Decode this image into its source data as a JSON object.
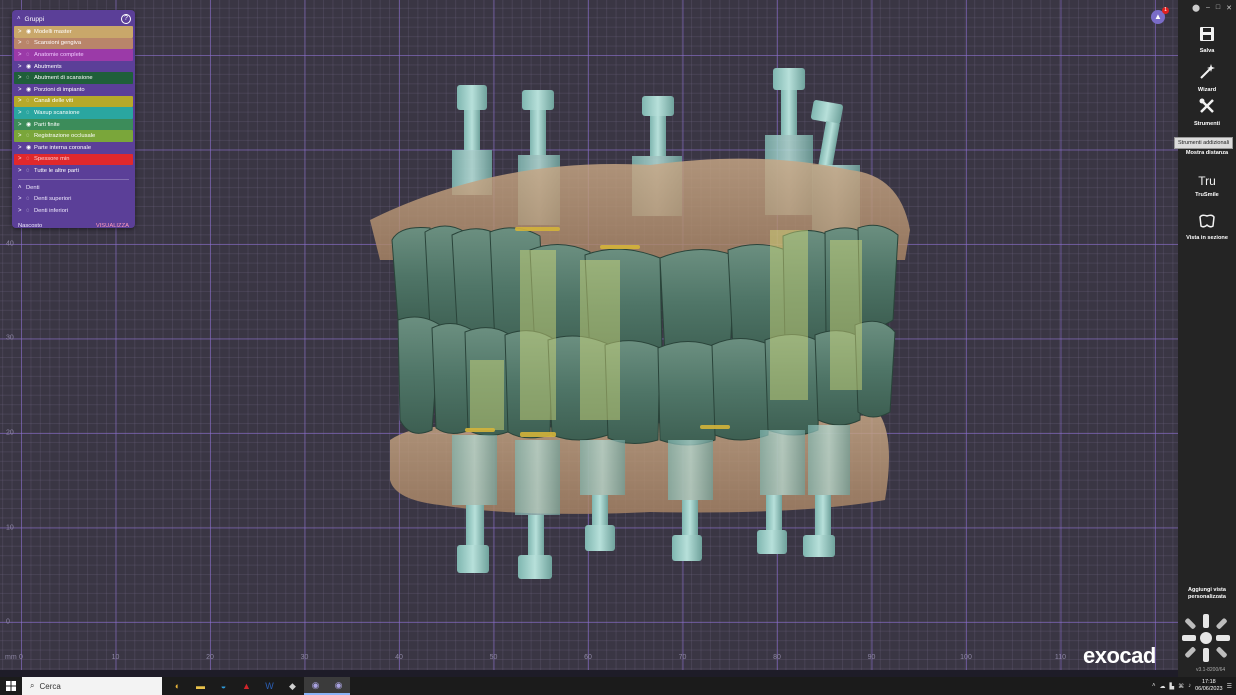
{
  "groups_panel": {
    "title": "Gruppi",
    "help_icon": "?",
    "items": [
      {
        "label": "Modelli master",
        "color": "#c9a76a",
        "arrow": ">",
        "eye": "◉",
        "text_color": "#ffffff"
      },
      {
        "label": "Scansioni gengiva",
        "color": "#b9856a",
        "arrow": ">",
        "eye": "◌",
        "text_color": "#ffffff"
      },
      {
        "label": "Anatomie complete",
        "color": "#9b3aa8",
        "arrow": ">",
        "eye": "◌",
        "text_color": "#f0c8ff"
      },
      {
        "label": "Abutments",
        "color": "#5b3f98",
        "arrow": ">",
        "eye": "◉",
        "text_color": "#ffffff"
      },
      {
        "label": "Abutment di scansione",
        "color": "#1f5f3a",
        "arrow": ">",
        "eye": "◌",
        "text_color": "#ffffff"
      },
      {
        "label": "Porzioni di impianto",
        "color": "#5b3f98",
        "arrow": ">",
        "eye": "◉",
        "text_color": "#ffffff"
      },
      {
        "label": "Canali delle viti",
        "color": "#b6a92a",
        "arrow": ">",
        "eye": "◌",
        "text_color": "#ffffff"
      },
      {
        "label": "Waxup scansione",
        "color": "#2aa6a0",
        "arrow": ">",
        "eye": "◌",
        "text_color": "#ffffff"
      },
      {
        "label": "Parti finite",
        "color": "#3c8c5a",
        "arrow": ">",
        "eye": "◉",
        "text_color": "#ffffff"
      },
      {
        "label": "Registrazione occlusale",
        "color": "#7aa63a",
        "arrow": ">",
        "eye": "◌",
        "text_color": "#ffffff"
      },
      {
        "label": "Parte interna coronale",
        "color": "#5b3f98",
        "arrow": ">",
        "eye": "◉",
        "text_color": "#ffffff"
      },
      {
        "label": "Spessore min",
        "color": "#e0282c",
        "arrow": ">",
        "eye": "◌",
        "text_color": "#ffd0d0"
      },
      {
        "label": "Tutte le altre parti",
        "color": "#5b3f98",
        "arrow": ">",
        "eye": "◌",
        "text_color": "#ffffff"
      }
    ],
    "denti_header": "Denti",
    "denti_items": [
      {
        "label": "Denti superiori",
        "arrow": ">",
        "eye": "◌"
      },
      {
        "label": "Denti inferiori",
        "arrow": ">",
        "eye": "◌"
      }
    ],
    "footer_left": "Nascosto",
    "footer_right": "VISUALIZZA"
  },
  "toolbar": {
    "window_controls": [
      "⬤",
      "–",
      "□",
      "✕"
    ],
    "buttons": [
      {
        "label": "Salva",
        "icon": "save-icon",
        "glyph": "💾"
      },
      {
        "label": "Wizard",
        "icon": "wand-icon",
        "glyph": "✨"
      },
      {
        "label": "Strumenti",
        "icon": "tools-icon",
        "glyph": "⚒"
      },
      {
        "label": "Mostra distanza",
        "icon": "distance-icon",
        "glyph": ""
      },
      {
        "label": "TruSmile",
        "icon": "trusmile-icon",
        "glyph": "Tru"
      },
      {
        "label": "Vista in sezione",
        "icon": "section-view-icon",
        "glyph": "◭"
      }
    ],
    "tooltip": "Strumenti addizionali",
    "custom_view": "Aggiungi vista personalizzata",
    "version": "v3.1-8200/64"
  },
  "notification": {
    "icon": "bell-icon",
    "badge": "1"
  },
  "logo": "exocad",
  "ruler": {
    "unit": "mm",
    "x_labels": [
      "0",
      "10",
      "20",
      "30",
      "40",
      "50",
      "60",
      "70",
      "80",
      "90",
      "100",
      "110"
    ],
    "y_labels": [
      "40",
      "30",
      "20",
      "10",
      "0"
    ]
  },
  "taskbar": {
    "search_placeholder": "Cerca",
    "apps": [
      {
        "name": "chrome-icon",
        "glyph": "◐",
        "color": "#e8b53a"
      },
      {
        "name": "folder-icon",
        "glyph": "▬",
        "color": "#e8c14a"
      },
      {
        "name": "edge-icon",
        "glyph": "◒",
        "color": "#2f9ad9"
      },
      {
        "name": "acrobat-icon",
        "glyph": "▲",
        "color": "#d0242a"
      },
      {
        "name": "word-icon",
        "glyph": "W",
        "color": "#2b5fb5"
      },
      {
        "name": "app-icon",
        "glyph": "◆",
        "color": "#cfcfcf"
      },
      {
        "name": "exocad-app-icon",
        "glyph": "◉",
        "color": "#a9a2e0"
      },
      {
        "name": "exocad-active-icon",
        "glyph": "◉",
        "color": "#a9a2e0"
      }
    ],
    "time": "17:18",
    "date": "06/06/2023",
    "tray_icons": [
      "˄",
      "☁",
      "▙",
      "⌘",
      "♪"
    ],
    "notification_icon": "☰"
  }
}
